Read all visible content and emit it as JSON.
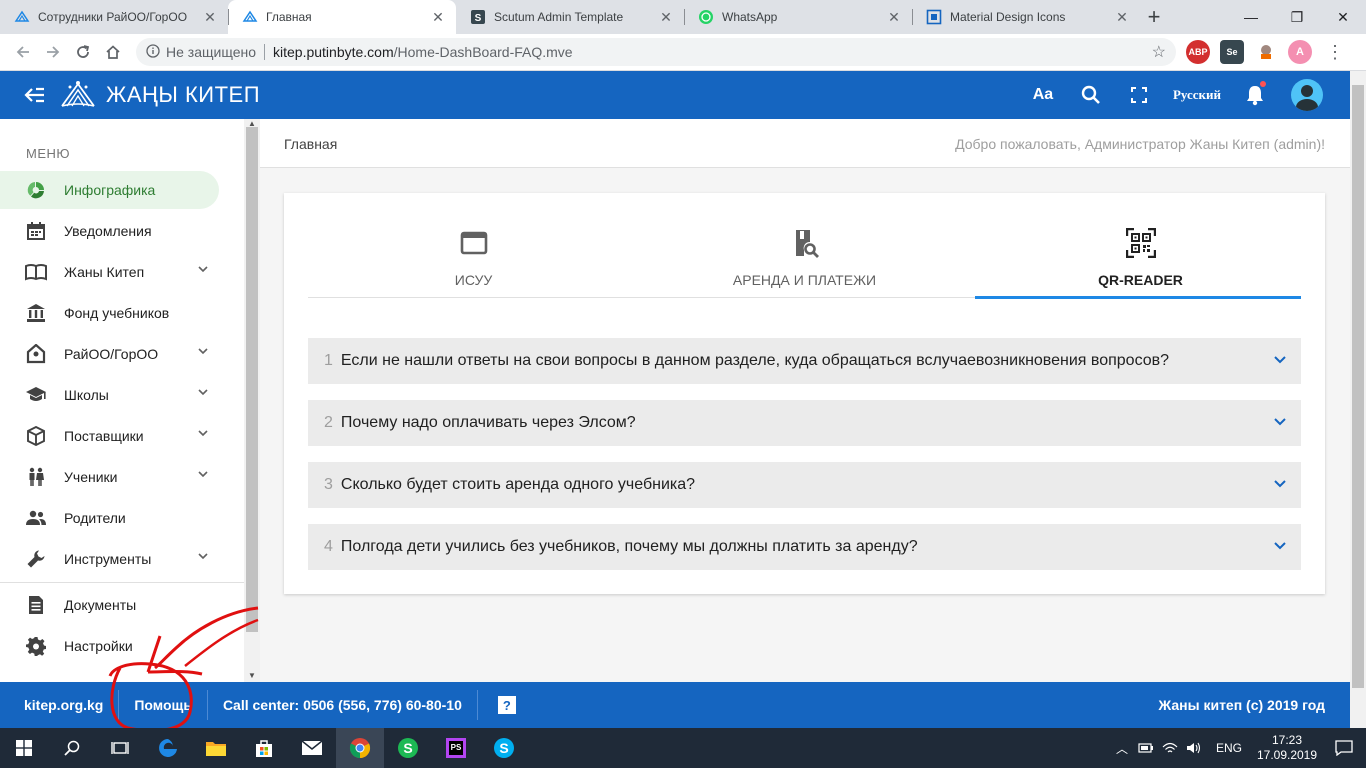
{
  "browser": {
    "tabs": [
      {
        "title": "Сотрудники РайОО/ГорОО",
        "icon": "kitep-favicon-icon",
        "active": false
      },
      {
        "title": "Главная",
        "icon": "kitep-favicon-icon",
        "active": true
      },
      {
        "title": "Scutum Admin Template",
        "icon": "scutum-favicon-icon",
        "active": false
      },
      {
        "title": "WhatsApp",
        "icon": "whatsapp-favicon-icon",
        "active": false
      },
      {
        "title": "Material Design Icons",
        "icon": "mdi-favicon-icon",
        "active": false
      }
    ],
    "new_tab": "+",
    "security_label": "Не защищено",
    "url_host": "kitep.putinbyte.com",
    "url_path": "/Home-DashBoard-FAQ.mve",
    "extensions": [
      "ABP",
      "Se"
    ],
    "profile_initial": "A"
  },
  "header": {
    "logo_text": "ЖАҢЫ КИТЕП",
    "font_button": "Aa",
    "language": "Русский"
  },
  "sidebar": {
    "caption": "МЕНЮ",
    "items": [
      {
        "label": "Инфографика",
        "icon": "infographic-icon",
        "expandable": false,
        "active": true
      },
      {
        "label": "Уведомления",
        "icon": "calendar-icon",
        "expandable": false
      },
      {
        "label": "Жаны Китеп",
        "icon": "book-open-icon",
        "expandable": true
      },
      {
        "label": "Фонд учебников",
        "icon": "bank-icon",
        "expandable": false
      },
      {
        "label": "РайОО/ГорОО",
        "icon": "home-pin-icon",
        "expandable": true
      },
      {
        "label": "Школы",
        "icon": "school-icon",
        "expandable": true
      },
      {
        "label": "Поставщики",
        "icon": "package-icon",
        "expandable": true
      },
      {
        "label": "Ученики",
        "icon": "students-icon",
        "expandable": true
      },
      {
        "label": "Родители",
        "icon": "parents-icon",
        "expandable": false
      },
      {
        "label": "Инструменты",
        "icon": "wrench-icon",
        "expandable": true
      },
      {
        "label": "Документы",
        "icon": "document-icon",
        "expandable": false
      },
      {
        "label": "Настройки",
        "icon": "gear-icon",
        "expandable": false
      }
    ]
  },
  "content": {
    "breadcrumb": "Главная",
    "welcome": "Добро пожаловать, Администратор Жаны Китеп (admin)!",
    "tabs": [
      {
        "label": "ИСУУ",
        "icon": "window-icon",
        "active": false
      },
      {
        "label": "АРЕНДА И ПЛАТЕЖИ",
        "icon": "book-search-icon",
        "active": false
      },
      {
        "label": "QR-READER",
        "icon": "qrcode-scan-icon",
        "active": true
      }
    ],
    "faq": [
      {
        "num": "1",
        "question": "Если не нашли ответы на свои вопросы в данном разделе, куда обращаться вслучаевозникновения вопросов?"
      },
      {
        "num": "2",
        "question": "Почему надо оплачивать через Элсом?"
      },
      {
        "num": "3",
        "question": "Сколько будет стоить аренда одного учебника?"
      },
      {
        "num": "4",
        "question": "Полгода дети учились без учебников, почему мы должны платить за аренду?"
      }
    ]
  },
  "footer": {
    "site": "kitep.org.kg",
    "help": "Помощь",
    "call_center": "Call center: 0506 (556, 776) 60-80-10",
    "help_icon": "?",
    "copyright": "Жаны китеп (c) 2019 год"
  },
  "taskbar": {
    "language": "ENG",
    "time": "17:23",
    "date": "17.09.2019"
  },
  "colors": {
    "brand_blue": "#1565c0",
    "active_tab_underline": "#1e88e5",
    "active_menu_bg": "#e8f5e9",
    "annotation_red": "#e01010"
  }
}
